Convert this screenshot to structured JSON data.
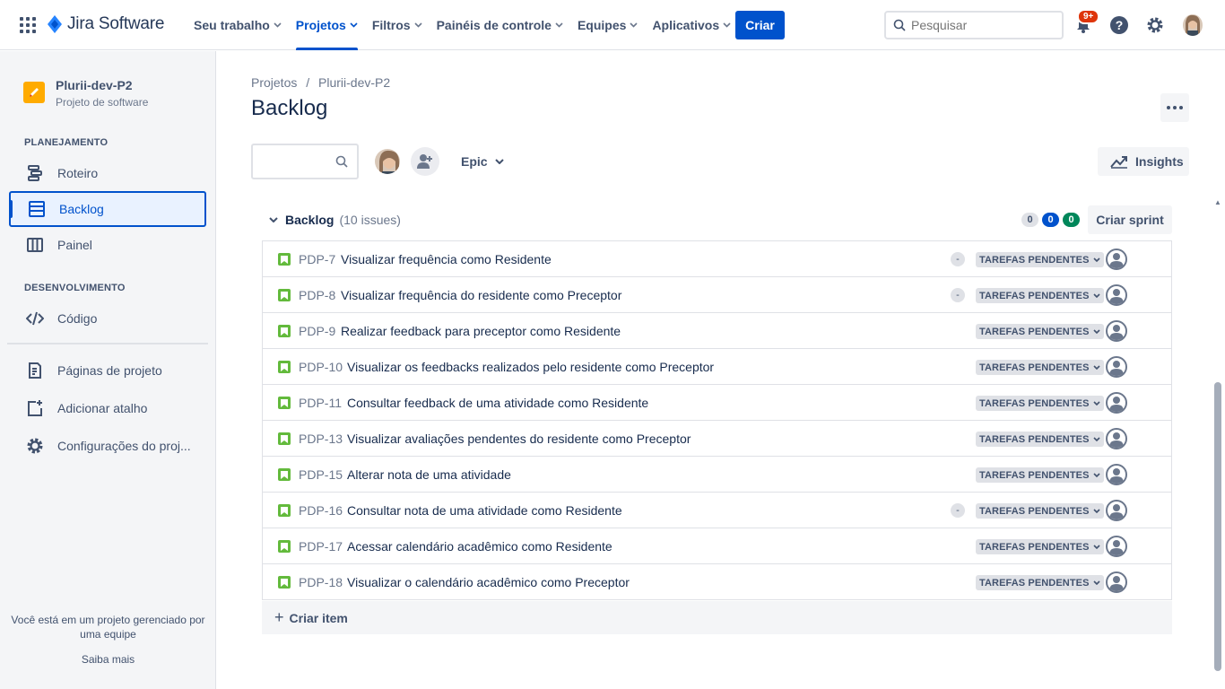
{
  "topnav": {
    "product": "Jira Software",
    "items": [
      {
        "label": "Seu trabalho",
        "active": false
      },
      {
        "label": "Projetos",
        "active": true
      },
      {
        "label": "Filtros",
        "active": false
      },
      {
        "label": "Painéis de controle",
        "active": false
      },
      {
        "label": "Equipes",
        "active": false
      },
      {
        "label": "Aplicativos",
        "active": false
      }
    ],
    "create_label": "Criar",
    "search_placeholder": "Pesquisar",
    "notifications_badge": "9+",
    "brand_color": "#0052cc"
  },
  "sidebar": {
    "project_name": "Plurii-dev-P2",
    "project_type": "Projeto de software",
    "planning_title": "PLANEJAMENTO",
    "planning_items": [
      {
        "label": "Roteiro",
        "icon": "roadmap-icon"
      },
      {
        "label": "Backlog",
        "icon": "backlog-icon",
        "active": true
      },
      {
        "label": "Painel",
        "icon": "board-icon"
      }
    ],
    "dev_title": "DESENVOLVIMENTO",
    "dev_items": [
      {
        "label": "Código",
        "icon": "code-icon"
      }
    ],
    "other_items": [
      {
        "label": "Páginas de projeto",
        "icon": "page-icon"
      },
      {
        "label": "Adicionar atalho",
        "icon": "add-shortcut-icon"
      },
      {
        "label": "Configurações do proj...",
        "icon": "gear-icon"
      }
    ],
    "footer_text": "Você está em um projeto gerenciado por uma equipe",
    "footer_link": "Saiba mais"
  },
  "main": {
    "breadcrumb": [
      "Projetos",
      "Plurii-dev-P2"
    ],
    "breadcrumb_sep": "/",
    "title": "Backlog",
    "epic_label": "Epic",
    "insights_label": "Insights",
    "backlog": {
      "title": "Backlog",
      "count": "(10 issues)",
      "counts": [
        "0",
        "0",
        "0"
      ],
      "create_sprint": "Criar sprint",
      "create_item": "Criar item",
      "issues": [
        {
          "key": "PDP-7",
          "summary": "Visualizar frequência como Residente",
          "dash": "-",
          "status": "TAREFAS PENDENTES"
        },
        {
          "key": "PDP-8",
          "summary": "Visualizar frequência do residente como Preceptor",
          "dash": "-",
          "status": "TAREFAS PENDENTES"
        },
        {
          "key": "PDP-9",
          "summary": "Realizar feedback para preceptor como Residente",
          "dash": "",
          "status": "TAREFAS PENDENTES"
        },
        {
          "key": "PDP-10",
          "summary": "Visualizar os feedbacks realizados pelo residente como Preceptor",
          "dash": "",
          "status": "TAREFAS PENDENTES"
        },
        {
          "key": "PDP-11",
          "summary": "Consultar feedback de uma atividade como Residente",
          "dash": "",
          "status": "TAREFAS PENDENTES"
        },
        {
          "key": "PDP-13",
          "summary": "Visualizar avaliações pendentes do residente como Preceptor",
          "dash": "",
          "status": "TAREFAS PENDENTES"
        },
        {
          "key": "PDP-15",
          "summary": "Alterar nota de uma atividade",
          "dash": "",
          "status": "TAREFAS PENDENTES"
        },
        {
          "key": "PDP-16",
          "summary": "Consultar nota de uma atividade como Residente",
          "dash": "-",
          "status": "TAREFAS PENDENTES"
        },
        {
          "key": "PDP-17",
          "summary": "Acessar calendário acadêmico como Residente",
          "dash": "",
          "status": "TAREFAS PENDENTES"
        },
        {
          "key": "PDP-18",
          "summary": "Visualizar o calendário acadêmico como Preceptor",
          "dash": "",
          "status": "TAREFAS PENDENTES"
        }
      ]
    }
  }
}
